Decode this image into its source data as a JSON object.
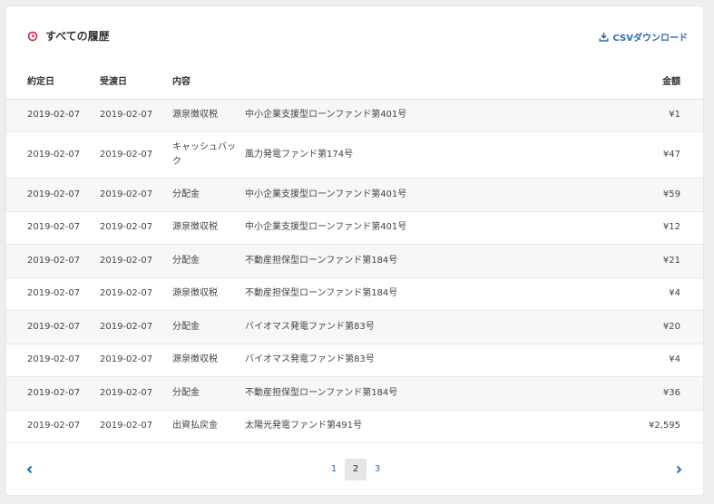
{
  "header": {
    "title": "すべての履歴",
    "csv_label": "CSVダウンロード",
    "accent_color": "#c81e3c",
    "link_color": "#2a6cb0"
  },
  "table": {
    "columns": [
      "約定日",
      "受渡日",
      "内容",
      "",
      "金額"
    ],
    "rows": [
      {
        "trade_date": "2019-02-07",
        "delivery_date": "2019-02-07",
        "type": "源泉徴収税",
        "fund": "中小企業支援型ローンファンド第401号",
        "amount": "¥1"
      },
      {
        "trade_date": "2019-02-07",
        "delivery_date": "2019-02-07",
        "type": "キャッシュバック",
        "fund": "風力発電ファンド第174号",
        "amount": "¥47"
      },
      {
        "trade_date": "2019-02-07",
        "delivery_date": "2019-02-07",
        "type": "分配金",
        "fund": "中小企業支援型ローンファンド第401号",
        "amount": "¥59"
      },
      {
        "trade_date": "2019-02-07",
        "delivery_date": "2019-02-07",
        "type": "源泉徴収税",
        "fund": "中小企業支援型ローンファンド第401号",
        "amount": "¥12"
      },
      {
        "trade_date": "2019-02-07",
        "delivery_date": "2019-02-07",
        "type": "分配金",
        "fund": "不動産担保型ローンファンド第184号",
        "amount": "¥21"
      },
      {
        "trade_date": "2019-02-07",
        "delivery_date": "2019-02-07",
        "type": "源泉徴収税",
        "fund": "不動産担保型ローンファンド第184号",
        "amount": "¥4"
      },
      {
        "trade_date": "2019-02-07",
        "delivery_date": "2019-02-07",
        "type": "分配金",
        "fund": "バイオマス発電ファンド第83号",
        "amount": "¥20"
      },
      {
        "trade_date": "2019-02-07",
        "delivery_date": "2019-02-07",
        "type": "源泉徴収税",
        "fund": "バイオマス発電ファンド第83号",
        "amount": "¥4"
      },
      {
        "trade_date": "2019-02-07",
        "delivery_date": "2019-02-07",
        "type": "分配金",
        "fund": "不動産担保型ローンファンド第184号",
        "amount": "¥36"
      },
      {
        "trade_date": "2019-02-07",
        "delivery_date": "2019-02-07",
        "type": "出資払戻金",
        "fund": "太陽光発電ファンド第491号",
        "amount": "¥2,595"
      }
    ]
  },
  "pagination": {
    "pages": [
      "1",
      "2",
      "3"
    ],
    "current": "2",
    "prev_icon": "chevron-left-icon",
    "next_icon": "chevron-right-icon"
  }
}
